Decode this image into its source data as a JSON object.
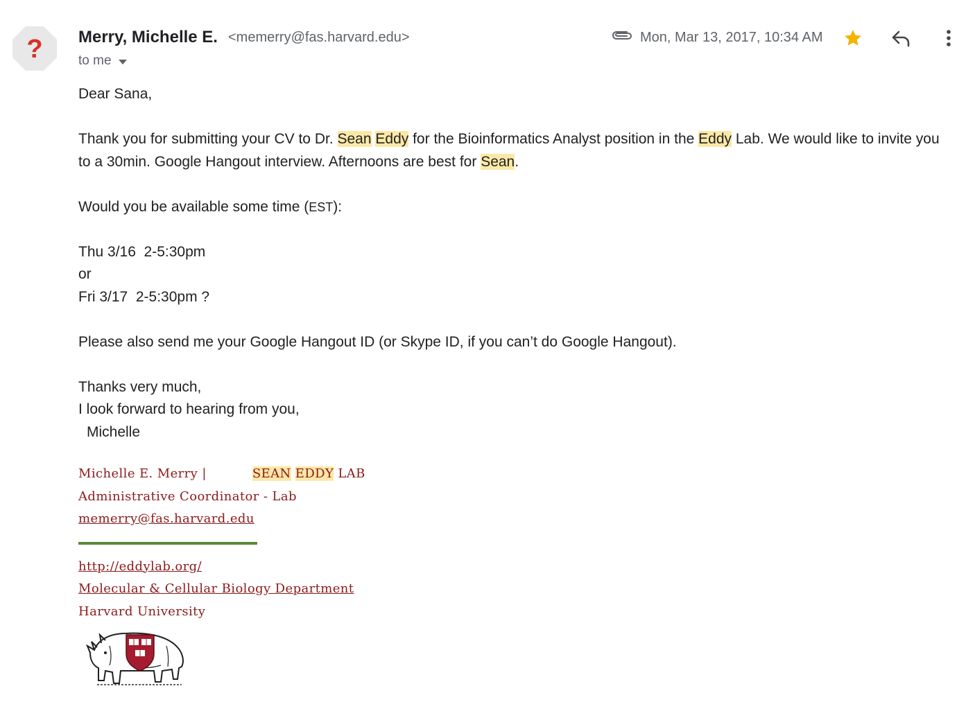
{
  "header": {
    "sender_name": "Merry, Michelle E.",
    "sender_email": "<memerry@fas.harvard.edu>",
    "recipient": "to me",
    "date": "Mon, Mar 13, 2017, 10:34 AM",
    "avatar_symbol": "?",
    "icons": [
      "paperclip-icon",
      "star-icon",
      "reply-icon",
      "more-vert-icon"
    ],
    "star_color": "#f4b400"
  },
  "body": {
    "greeting": "Dear Sana,",
    "p1": {
      "t1": "Thank you for submitting your CV to Dr. ",
      "h1": "Sean",
      "t2": " ",
      "h2": "Eddy",
      "t3": " for the Bioinformatics Analyst position in the ",
      "h3": "Eddy",
      "t4": " Lab. We would like to invite you to a 30min. Google Hangout interview. Afternoons are best for ",
      "h4": "Sean",
      "t5": "."
    },
    "p2": {
      "t1": "Would you be available some time (",
      "sc": "EST",
      "t2": "):"
    },
    "options": [
      "Thu 3/16  2-5:30pm",
      "or",
      "Fri 3/17  2-5:30pm ?"
    ],
    "p3": "Please also send me your Google Hangout ID (or Skype ID, if you can’t do Google Hangout).",
    "closing": [
      "Thanks very much,",
      "I look forward to hearing from you,",
      "Michelle"
    ],
    "highlight_color": "#fce8a6"
  },
  "signature": {
    "name_line": "Michelle E. Merry   |",
    "lab_h1": "SEAN",
    "lab_h2": "EDDY",
    "lab_rest": "LAB",
    "title": "Administrative Coordinator - Lab",
    "email": "memerry@fas.harvard.edu",
    "website": "http://eddylab.org/",
    "department": "Molecular & Cellular Biology Department",
    "university": "Harvard University",
    "color": "#8b1a1a",
    "rule_color": "#5a8a3c"
  }
}
